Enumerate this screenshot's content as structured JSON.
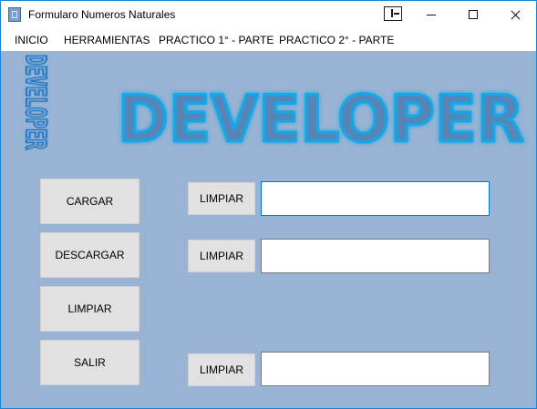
{
  "window": {
    "title": "Formularo Numeros Naturales"
  },
  "menu": {
    "items": [
      "INICIO",
      "HERRAMIENTAS",
      "PRACTICO 1° - PARTE",
      "PRACTICO 2° - PARTE"
    ]
  },
  "logo": {
    "main_text": "DEVELOPER",
    "vertical_text": "DEVELOPER"
  },
  "buttons": {
    "cargar": "CARGAR",
    "descargar": "DESCARGAR",
    "limpiar": "LIMPIAR",
    "salir": "SALIR"
  },
  "fields": [
    {
      "button_label": "LIMPIAR",
      "value": ""
    },
    {
      "button_label": "LIMPIAR",
      "value": ""
    },
    {
      "button_label": "LIMPIAR",
      "value": ""
    }
  ],
  "colors": {
    "form_background": "#98b3d3",
    "logo_neon": "#19a7e6",
    "focus_border": "#0078d7"
  }
}
